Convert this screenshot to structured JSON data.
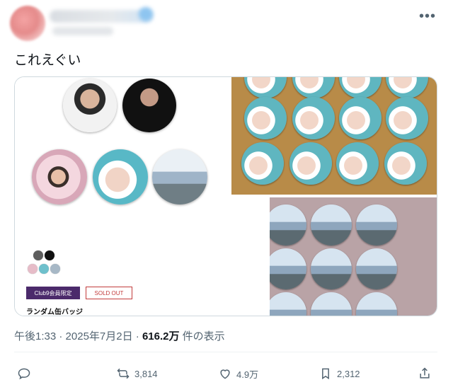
{
  "tweet": {
    "text": "これえぐい",
    "more_icon": "more-horizontal-icon"
  },
  "media": {
    "button_club": "Club9会員限定",
    "button_soldout": "SOLD OUT",
    "product_name": "ランダム缶バッジ"
  },
  "meta": {
    "time": "午後1:33",
    "separator": "·",
    "date": "2025年7月2日",
    "views_count": "616.2万",
    "views_label": "件の表示"
  },
  "actions": {
    "reply": {
      "icon": "reply-icon",
      "count": ""
    },
    "retweet": {
      "icon": "retweet-icon",
      "count": "3,814"
    },
    "like": {
      "icon": "heart-icon",
      "count": "4.9万"
    },
    "bookmark": {
      "icon": "bookmark-icon",
      "count": "2,312"
    },
    "share": {
      "icon": "share-icon",
      "count": ""
    }
  },
  "colors": {
    "club_button": "#4b2a6b",
    "soldout": "#c23b3b",
    "meta_text": "#536471"
  }
}
